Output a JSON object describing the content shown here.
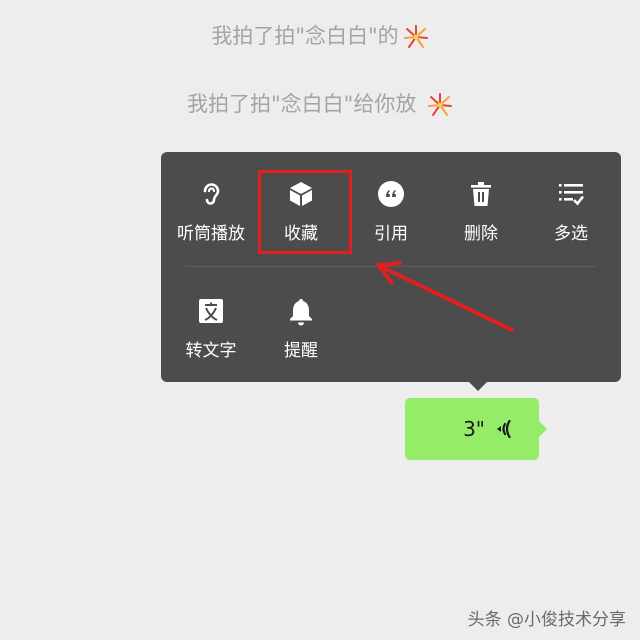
{
  "system_messages": [
    {
      "text": "我拍了拍\"念白白\"的"
    },
    {
      "text": "我拍了拍\"念白白\"给你放 "
    }
  ],
  "context_menu": {
    "row1": [
      {
        "label": "听筒播放",
        "icon": "ear-icon"
      },
      {
        "label": "收藏",
        "icon": "cube-icon"
      },
      {
        "label": "引用",
        "icon": "quote-icon"
      },
      {
        "label": "删除",
        "icon": "trash-icon"
      },
      {
        "label": "多选",
        "icon": "multi-select-icon"
      }
    ],
    "row2": [
      {
        "label": "转文字",
        "icon": "text-convert-icon"
      },
      {
        "label": "提醒",
        "icon": "bell-icon"
      }
    ]
  },
  "voice_message": {
    "duration": "3\""
  },
  "watermark": "头条 @小俊技术分享",
  "colors": {
    "background": "#ededed",
    "menu_bg": "#4c4c4c",
    "bubble_green": "#95ec69",
    "highlight_red": "#e02020"
  }
}
